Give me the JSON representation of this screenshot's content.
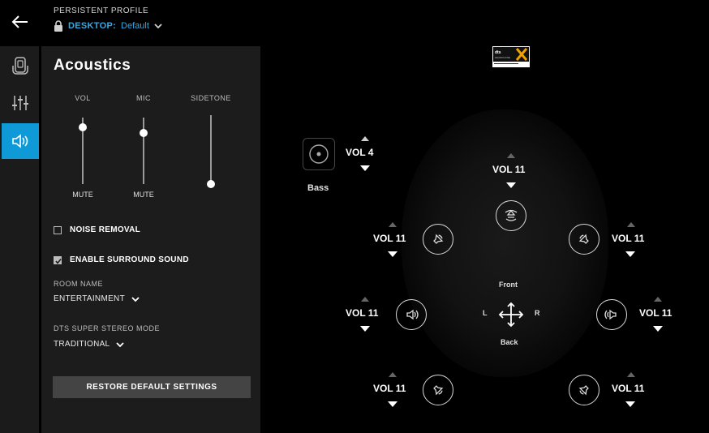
{
  "header": {
    "profile_caption": "PERSISTENT PROFILE",
    "profile_name": "DESKTOP:",
    "profile_value": "Default"
  },
  "rail": {
    "items": [
      {
        "icon": "device-icon",
        "active": false
      },
      {
        "icon": "equalizer-icon",
        "active": false
      },
      {
        "icon": "acoustics-icon",
        "active": true
      }
    ]
  },
  "acoustics": {
    "title": "Acoustics",
    "sliders": [
      {
        "label": "VOL",
        "footer": "MUTE",
        "value": 0.87
      },
      {
        "label": "MIC",
        "footer": "MUTE",
        "value": 0.75
      },
      {
        "label": "SIDETONE",
        "footer": "",
        "value": 0.0
      }
    ],
    "noise_removal": {
      "label": "NOISE REMOVAL",
      "checked": false
    },
    "surround": {
      "label": "ENABLE SURROUND SOUND",
      "checked": true
    },
    "room": {
      "caption": "ROOM NAME",
      "value": "ENTERTAINMENT"
    },
    "dts_mode": {
      "caption": "DTS SUPER STEREO MODE",
      "value": "TRADITIONAL"
    },
    "restore_label": "RESTORE DEFAULT SETTINGS"
  },
  "surround": {
    "bass": {
      "label": "Bass",
      "vol": "VOL 4"
    },
    "center": {
      "vol": "VOL 11"
    },
    "front_left": {
      "vol": "VOL 11"
    },
    "front_right": {
      "vol": "VOL 11"
    },
    "side_left": {
      "vol": "VOL 11"
    },
    "side_right": {
      "vol": "VOL 11"
    },
    "rear_left": {
      "vol": "VOL 11"
    },
    "rear_right": {
      "vol": "VOL 11"
    },
    "compass": {
      "front": "Front",
      "back": "Back",
      "left": "L",
      "right": "R"
    }
  },
  "colors": {
    "accent": "#0f9ad7",
    "profile_text": "#33a9e6",
    "panel": "#1c1c1c"
  }
}
